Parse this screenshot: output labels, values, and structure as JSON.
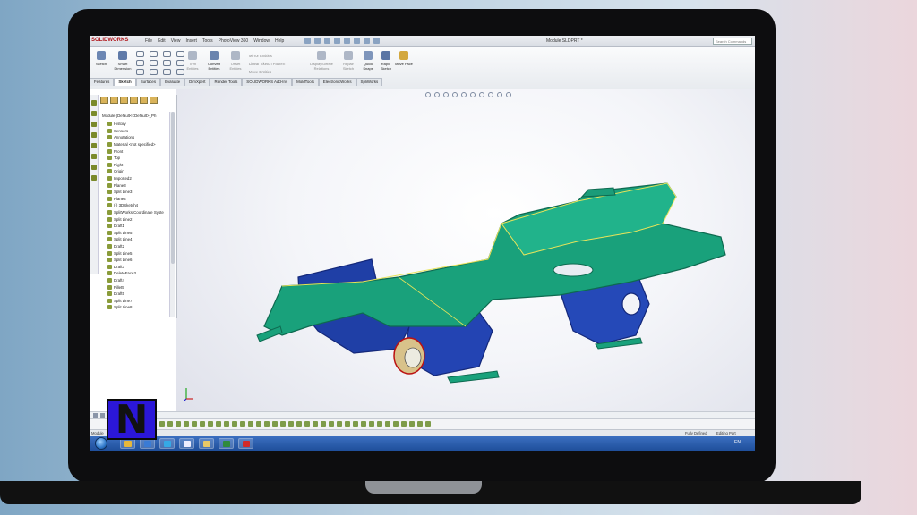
{
  "app": {
    "logo": "SOLIDWORKS",
    "document_title": "Module SLDPRT *",
    "search_placeholder": "Search Commands"
  },
  "menu": [
    "File",
    "Edit",
    "View",
    "Insert",
    "Tools",
    "PhotoView 360",
    "Window",
    "Help"
  ],
  "ribbon": {
    "sketch": "Sketch",
    "smart_dimension": "Smart Dimension",
    "trim_entities": "Trim Entities",
    "convert_entities": "Convert Entities",
    "offset_entities": "Offset Entities",
    "mirror_entities": "Mirror Entities",
    "linear_sketch_pattern": "Linear Sketch Pattern",
    "move_entities": "Move Entities",
    "display_delete_relations": "Display/Delete Relations",
    "repair_sketch": "Repair Sketch",
    "quick_snaps": "Quick Snaps",
    "rapid_sketch": "Rapid Sketch",
    "move_face": "Move Face"
  },
  "ribbon_tabs": [
    "Features",
    "Sketch",
    "Surfaces",
    "Evaluate",
    "DimXpert",
    "Render Tools",
    "SOLIDWORKS Add-Ins",
    "MoldTools",
    "ElectronicWorks",
    "SpliWorks"
  ],
  "active_ribbon_tab": "Sketch",
  "feature_tree": {
    "root": "Module  (Default<<Default>_Ph",
    "items": [
      "History",
      "Sensors",
      "Annotations",
      "Material <not specified>",
      "Front",
      "Top",
      "Right",
      "Origin",
      "Imported2",
      "Plane3",
      "Split Line3",
      "Plane4",
      "(-) 3DSketch4",
      "SplitWorks Coordinate Syste",
      "Split Line2",
      "Draft1",
      "Split Line5",
      "Split Line4",
      "Draft2",
      "Split Line5",
      "Split Line6",
      "Draft3",
      "DeleteFace3",
      "Draft4",
      "Fillet5",
      "Draft5",
      "Split Line7",
      "Split Line8"
    ]
  },
  "status": {
    "app": "Module",
    "defined": "Fully Defined",
    "mode": "Editing Part",
    "language": "EN"
  },
  "taskbar": {
    "apps": [
      "chrome-icon",
      "outlook-icon",
      "skype-icon",
      "notepad-icon",
      "explorer-icon",
      "excel-icon",
      "solidworks-icon"
    ]
  },
  "logo_overlay": {
    "text": "N"
  },
  "colors": {
    "model_green": "#19a17b",
    "model_blue": "#1f3fa6",
    "logo_blue": "#2b17d8",
    "taskbar": "#2a5fb3"
  }
}
